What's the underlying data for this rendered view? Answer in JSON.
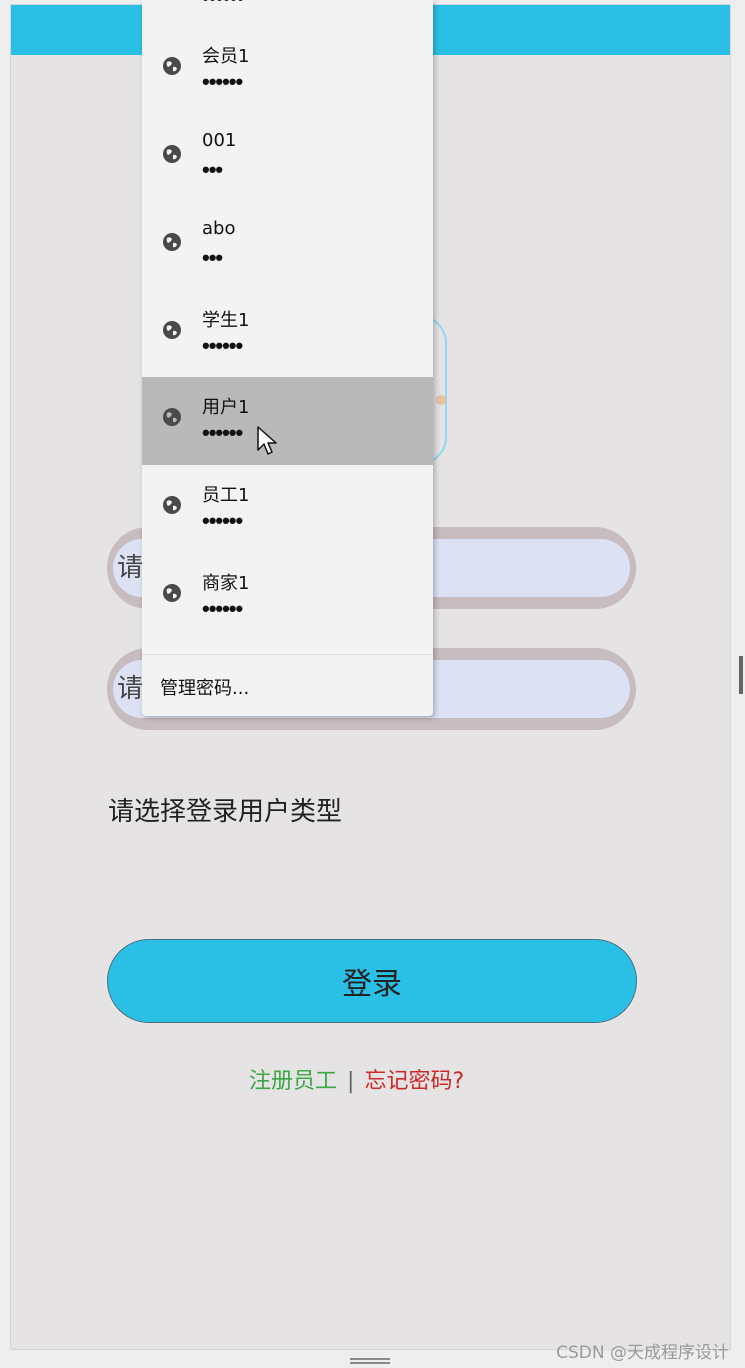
{
  "form": {
    "username_placeholder": "请输入账号",
    "password_placeholder": "请输入密码",
    "user_type_label": "请选择登录用户类型",
    "login_label": "登录",
    "register_link": "注册员工",
    "separator": "|",
    "forgot_link": "忘记密码?"
  },
  "autofill": {
    "top_partial_dots": "••••••",
    "items": [
      {
        "username": "会员1",
        "password": "••••••"
      },
      {
        "username": "001",
        "password": "•••"
      },
      {
        "username": "abo",
        "password": "•••"
      },
      {
        "username": "学生1",
        "password": "••••••"
      },
      {
        "username": "用户1",
        "password": "••••••"
      },
      {
        "username": "员工1",
        "password": "••••••"
      },
      {
        "username": "商家1",
        "password": "••••••"
      }
    ],
    "manage_label": "管理密码...",
    "active_item_label": "用户1"
  },
  "watermark": "CSDN @天成程序设计",
  "colors": {
    "accent": "#2ac0e6",
    "page_bg": "#e6e3e5",
    "register_green": "#3aa845",
    "forgot_red": "#cc2a2a"
  },
  "icons": {
    "autofill_item": "globe-icon",
    "pointer": "mouse-cursor-icon"
  }
}
